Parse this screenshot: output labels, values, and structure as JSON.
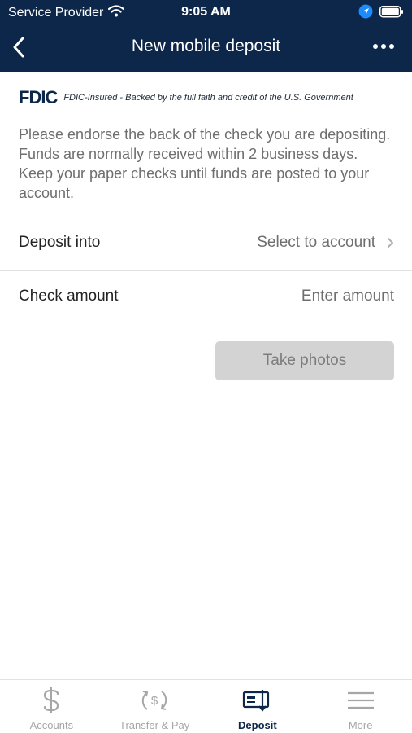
{
  "status_bar": {
    "carrier": "Service Provider",
    "time": "9:05 AM"
  },
  "nav": {
    "title": "New mobile deposit"
  },
  "fdic": {
    "logo_text": "FDIC",
    "notice": "FDIC-Insured - Backed by the full faith and credit of the U.S. Government"
  },
  "intro_text": "Please endorse the back of the check you are depositing. Funds are normally received within 2 business days. Keep your paper checks until funds are posted to your account.",
  "deposit_into": {
    "label": "Deposit into",
    "value": "Select to account"
  },
  "check_amount": {
    "label": "Check amount",
    "placeholder": "Enter amount"
  },
  "take_photos_label": "Take photos",
  "tabs": [
    {
      "label": "Accounts",
      "icon": "dollar-icon",
      "active": false
    },
    {
      "label": "Transfer & Pay",
      "icon": "transfer-icon",
      "active": false
    },
    {
      "label": "Deposit",
      "icon": "deposit-check-icon",
      "active": true
    },
    {
      "label": "More",
      "icon": "hamburger-menu-icon",
      "active": false
    }
  ],
  "colors": {
    "header_bg": "#0c2749",
    "active_tab": "#0c2749",
    "inactive_tab": "#a6a6a6",
    "location_arrow": "#1a8cff"
  }
}
